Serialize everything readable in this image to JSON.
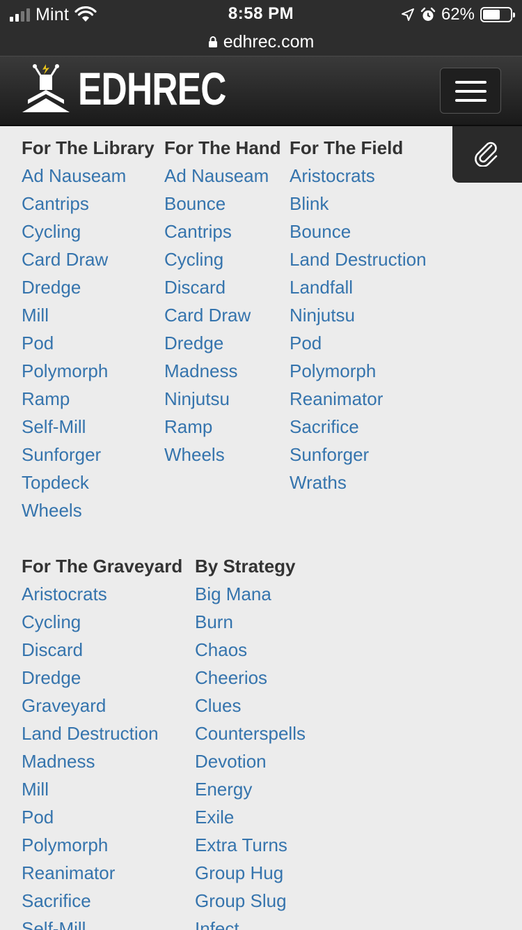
{
  "status_bar": {
    "carrier": "Mint",
    "time": "8:58 PM",
    "battery_percent": "62%",
    "battery_level": 0.62,
    "icons": [
      "signal-icon",
      "wifi-icon",
      "location-icon",
      "alarm-icon",
      "battery-icon"
    ]
  },
  "browser": {
    "url": "edhrec.com",
    "lock_icon": "lock-icon"
  },
  "header": {
    "logo_text": "EDHREC",
    "menu_icon": "hamburger-menu-icon",
    "side_tab_icon": "paperclip-icon"
  },
  "sections": [
    {
      "columns": [
        {
          "title": "For The Library",
          "items": [
            "Ad Nauseam",
            "Cantrips",
            "Cycling",
            "Card Draw",
            "Dredge",
            "Mill",
            "Pod",
            "Polymorph",
            "Ramp",
            "Self-Mill",
            "Sunforger",
            "Topdeck",
            "Wheels"
          ]
        },
        {
          "title": "For The Hand",
          "items": [
            "Ad Nauseam",
            "Bounce",
            "Cantrips",
            "Cycling",
            "Discard",
            "Card Draw",
            "Dredge",
            "Madness",
            "Ninjutsu",
            "Ramp",
            "Wheels"
          ]
        },
        {
          "title": "For The Field",
          "items": [
            "Aristocrats",
            "Blink",
            "Bounce",
            "Land Destruction",
            "Landfall",
            "Ninjutsu",
            "Pod",
            "Polymorph",
            "Reanimator",
            "Sacrifice",
            "Sunforger",
            "Wraths"
          ]
        }
      ]
    },
    {
      "columns": [
        {
          "title": "For The Graveyard",
          "items": [
            "Aristocrats",
            "Cycling",
            "Discard",
            "Dredge",
            "Graveyard",
            "Land Destruction",
            "Madness",
            "Mill",
            "Pod",
            "Polymorph",
            "Reanimator",
            "Sacrifice",
            "Self-Mill"
          ]
        },
        {
          "title": "By Strategy",
          "items": [
            "Big Mana",
            "Burn",
            "Chaos",
            "Cheerios",
            "Clues",
            "Counterspells",
            "Devotion",
            "Energy",
            "Exile",
            "Extra Turns",
            "Group Hug",
            "Group Slug",
            "Infect"
          ]
        }
      ]
    }
  ],
  "colors": {
    "link": "#3574ad",
    "heading": "#333333",
    "background": "#ececec",
    "header_bg": "#2d2d2d"
  }
}
